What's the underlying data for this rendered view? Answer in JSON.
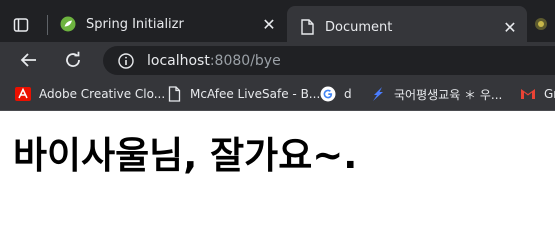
{
  "tabs": [
    {
      "title": "Spring Initializr",
      "icon": "spring-icon",
      "active": false
    },
    {
      "title": "Document",
      "icon": "document-icon",
      "active": true
    }
  ],
  "address_bar": {
    "host": "localhost",
    "rest": ":8080/bye"
  },
  "bookmarks": [
    {
      "label": "Adobe Creative Clo...",
      "icon": "adobe-icon"
    },
    {
      "label": "McAfee LiveSafe - B...",
      "icon": "page-icon"
    },
    {
      "label": "d",
      "icon": "google-icon"
    },
    {
      "label": "국어평생교육 ＊ 우...",
      "icon": "feather-icon"
    },
    {
      "label": "Gr",
      "icon": "gmail-icon"
    }
  ],
  "page": {
    "heading": "바이사울님, 잘가요~."
  },
  "colors": {
    "chrome_bg": "#202124",
    "toolbar_bg": "#35363a",
    "text": "#e8eaed",
    "url_muted": "#9aa0a6",
    "spring_green": "#6db33f"
  }
}
